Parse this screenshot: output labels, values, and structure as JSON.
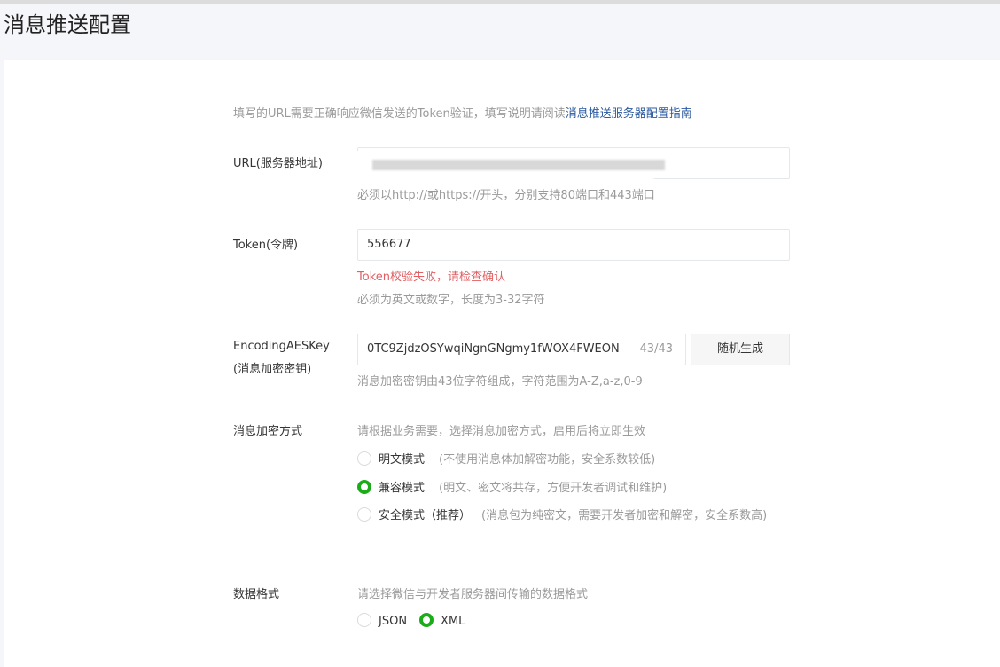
{
  "title": "消息推送配置",
  "intro": {
    "text": "填写的URL需要正确响应微信发送的Token验证，填写说明请阅读",
    "link": "消息推送服务器配置指南"
  },
  "url": {
    "label": "URL(服务器地址)",
    "hint": "必须以http://或https://开头，分别支持80端口和443端口"
  },
  "token": {
    "label": "Token(令牌)",
    "value": "556677",
    "error": "Token校验失败，请检查确认",
    "hint": "必须为英文或数字，长度为3-32字符"
  },
  "aes": {
    "label1": "EncodingAESKey",
    "label2": "(消息加密密钥)",
    "value": "0TC9ZjdzOSYwqiNgnGNgmy1fWOX4FWEON",
    "counter": "43/43",
    "button": "随机生成",
    "hint": "消息加密密钥由43位字符组成，字符范围为A-Z,a-z,0-9"
  },
  "encrypt": {
    "label": "消息加密方式",
    "hint": "请根据业务需要，选择消息加密方式，启用后将立即生效",
    "options": [
      {
        "label": "明文模式",
        "desc": "(不使用消息体加解密功能，安全系数较低)",
        "selected": false
      },
      {
        "label": "兼容模式",
        "desc": "(明文、密文将共存，方便开发者调试和维护)",
        "selected": true
      },
      {
        "label": "安全模式（推荐）",
        "desc": "(消息包为纯密文，需要开发者加密和解密，安全系数高)",
        "selected": false
      }
    ]
  },
  "format": {
    "label": "数据格式",
    "hint": "请选择微信与开发者服务器间传输的数据格式",
    "options": [
      {
        "label": "JSON",
        "selected": false
      },
      {
        "label": "XML",
        "selected": true
      }
    ]
  },
  "colors": {
    "accent": "#1aad19",
    "error": "#e15f63",
    "link": "#2b5aa0"
  }
}
